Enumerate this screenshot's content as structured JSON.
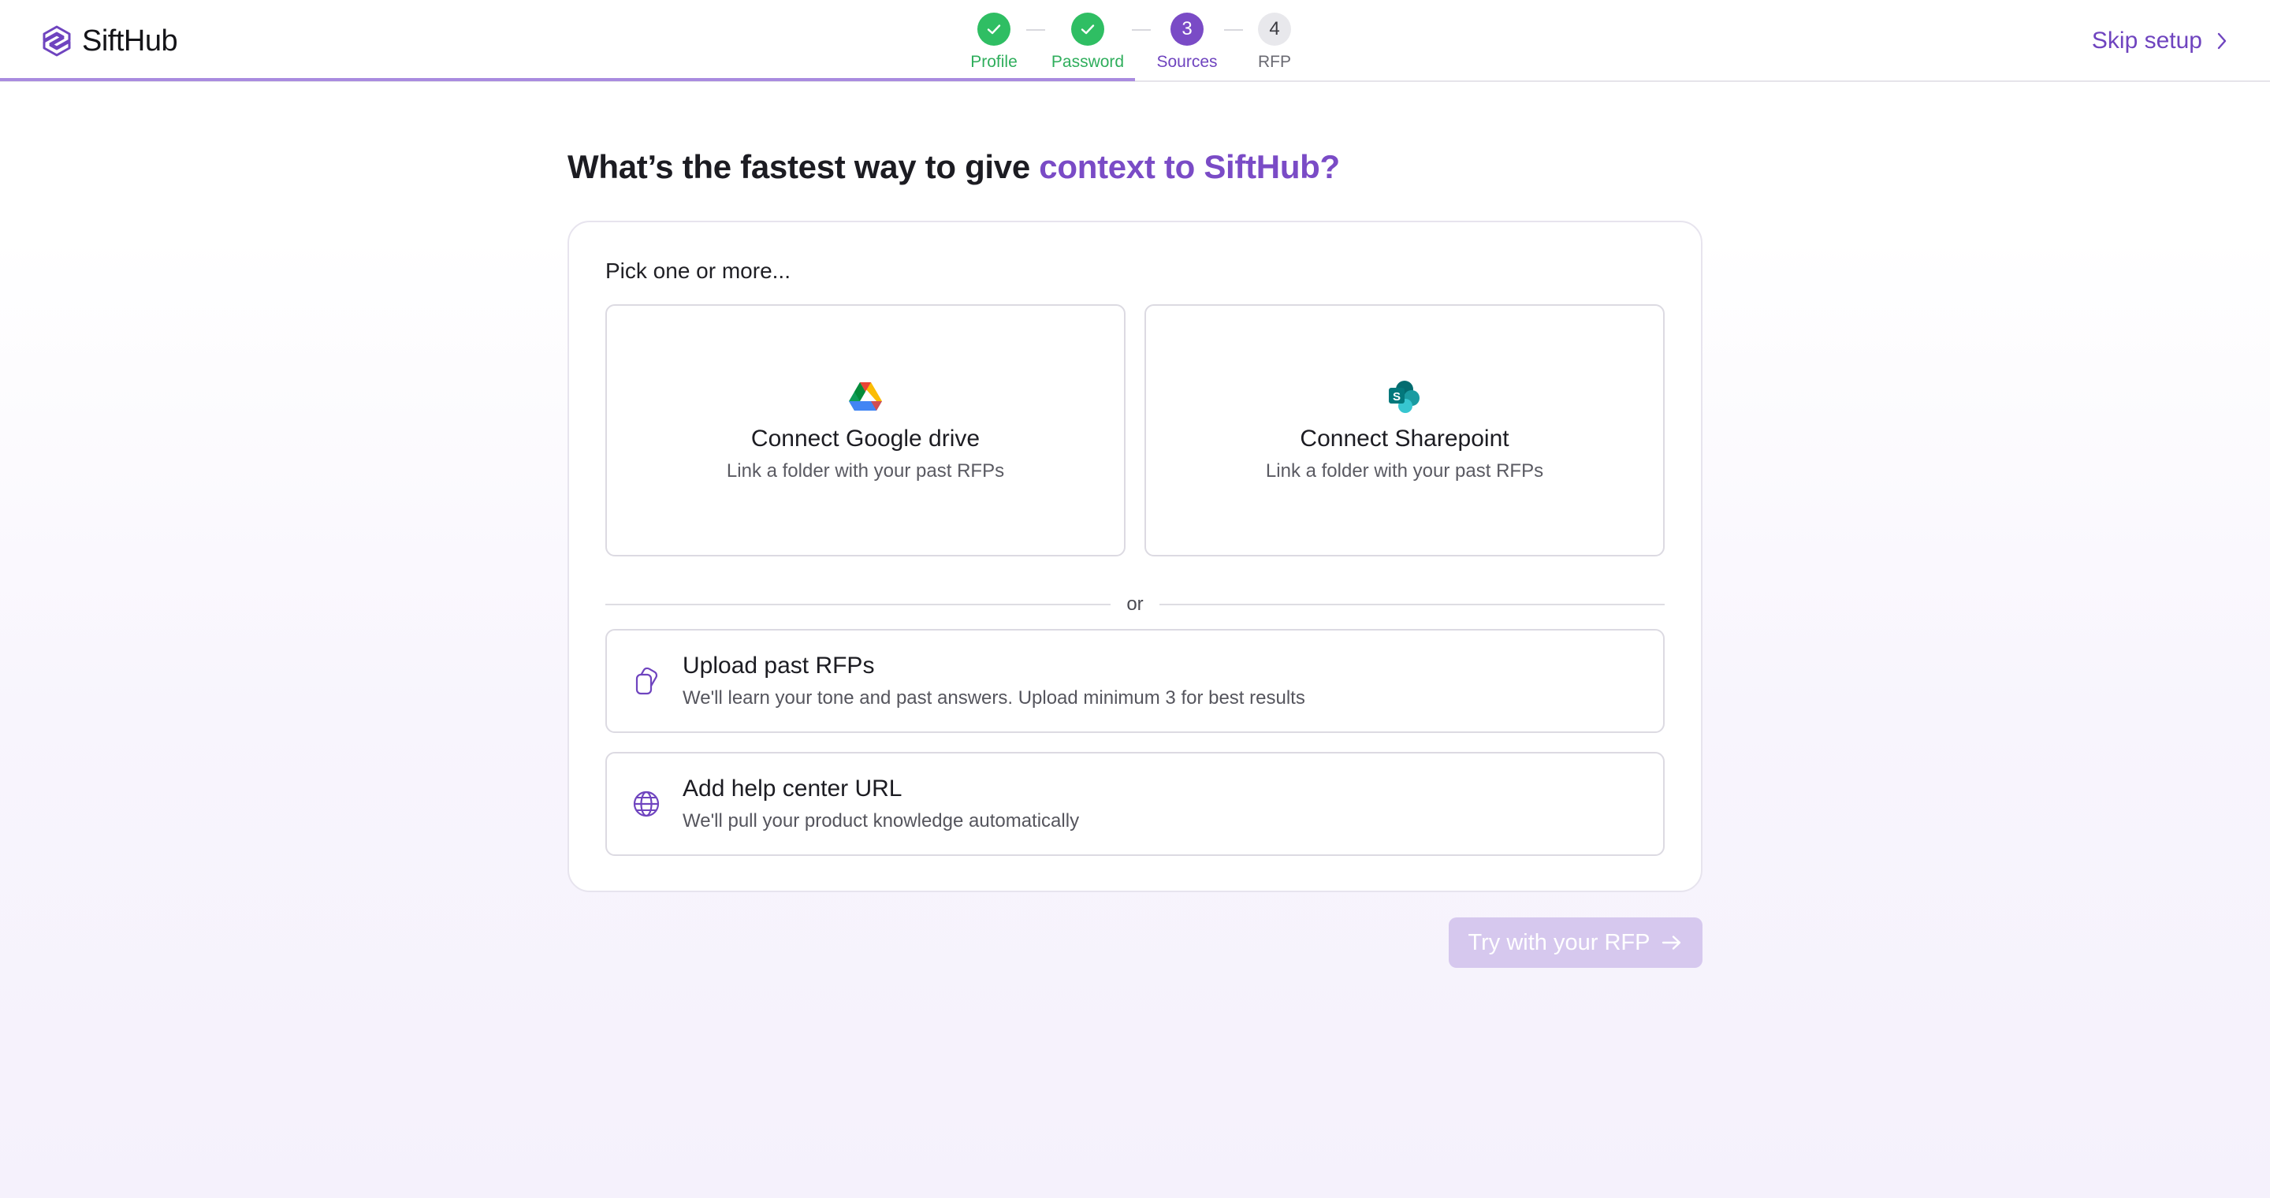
{
  "brand": {
    "name": "SiftHub",
    "accent_color": "#7a4bc6",
    "success_color": "#2fbe63"
  },
  "stepper": {
    "steps": [
      {
        "number": "1",
        "label": "Profile",
        "state": "done"
      },
      {
        "number": "2",
        "label": "Password",
        "state": "done"
      },
      {
        "number": "3",
        "label": "Sources",
        "state": "active"
      },
      {
        "number": "4",
        "label": "RFP",
        "state": "pending"
      }
    ]
  },
  "header": {
    "skip_label": "Skip setup"
  },
  "main": {
    "heading_prefix": "What’s the fastest way to give ",
    "heading_accent": "context to SiftHub?",
    "pick_label": "Pick one or more...",
    "tiles": [
      {
        "icon": "google-drive-icon",
        "title": "Connect Google drive",
        "subtitle": "Link a folder with your past RFPs"
      },
      {
        "icon": "sharepoint-icon",
        "title": "Connect Sharepoint",
        "subtitle": "Link a folder with your past RFPs"
      }
    ],
    "divider_label": "or",
    "options": [
      {
        "icon": "documents-icon",
        "title": "Upload past RFPs",
        "subtitle": "We'll learn your tone and past answers. Upload minimum 3 for best results"
      },
      {
        "icon": "globe-icon",
        "title": "Add help center URL",
        "subtitle": "We'll pull your product knowledge automatically"
      }
    ],
    "cta_label": "Try with your RFP"
  }
}
